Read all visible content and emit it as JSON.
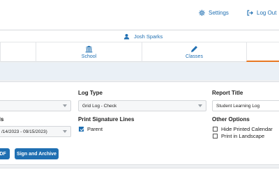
{
  "header": {
    "settings_label": "Settings",
    "logout_label": "Log Out"
  },
  "user": {
    "name": "Josh Sparks"
  },
  "tabs": [
    {
      "label": "School",
      "icon": "institution-icon"
    },
    {
      "label": "Classes",
      "icon": "pencil-icon"
    }
  ],
  "form": {
    "log_type": {
      "label": "Log Type",
      "value": "Grid Log - Check"
    },
    "report_title": {
      "label": "Report Title",
      "value": "Student Learning Log"
    },
    "period": {
      "label_fragment": "ds",
      "value_fragment": "/14/2023 - 09/15/2023)"
    },
    "signature": {
      "label": "Print Signature Lines",
      "options": [
        {
          "label": "Parent",
          "checked": true
        }
      ]
    },
    "other": {
      "label": "Other Options",
      "options": [
        {
          "label": "Hide Printed Calendar",
          "checked": false
        },
        {
          "label": "Print in Landscape",
          "checked": false
        }
      ]
    }
  },
  "buttons": {
    "pdf_fragment": "DF",
    "sign_archive": "Sign and Archive"
  },
  "colors": {
    "accent": "#1f6fb2",
    "active_tab": "#e87722"
  }
}
